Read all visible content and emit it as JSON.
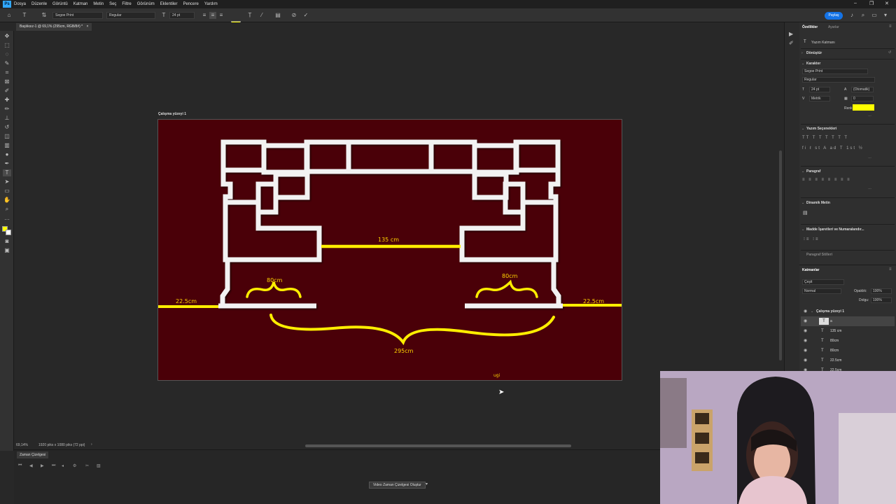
{
  "menubar": {
    "items": [
      "Dosya",
      "Düzenle",
      "Görüntü",
      "Katman",
      "Metin",
      "Seç",
      "Filtre",
      "Görünüm",
      "Eklentiler",
      "Pencere",
      "Yardım"
    ]
  },
  "options": {
    "font_family": "Segoe Print",
    "font_style": "Regular",
    "font_size": "24 pt",
    "color": "#ffff00",
    "share_label": "Paylaş"
  },
  "document": {
    "tab_title": "Başlıksız-1 @ 69,1% (295cm, RGB/8#) *",
    "artboard_label": "Çalışma yüzeyi 1"
  },
  "canvas": {
    "background": "#4a0008",
    "labels": {
      "middle": "135 cm",
      "left_shelf": "80cm",
      "right_shelf": "80cm",
      "left_side": "22.5cm",
      "right_side": "22.5cm",
      "total": "295cm",
      "typing": "ugi"
    }
  },
  "status": {
    "zoom": "69,14%",
    "size": "1920 piks x 1080 piks (72 ppi)"
  },
  "timeline": {
    "tab": "Zaman Çizelgesi",
    "create_button": "Video Zaman Çizelgesi Oluştur"
  },
  "properties": {
    "tabs": [
      "Özellikler",
      "Ayarlar"
    ],
    "layer_type": "Yazım Katmanı",
    "sections": {
      "transform": "Dönüştür",
      "character": "Karakter",
      "type_options": "Yazım Seçenekleri",
      "paragraph": "Paragraf",
      "dynamic_text": "Dinamik Metin",
      "bullets": "Madde İşaretleri ve Numaralandır...",
      "paragraph_styles": "Paragraf Stilleri"
    },
    "font_family": "Segoe Print",
    "font_style": "Regular",
    "size": "24 pt",
    "leading": "(Otomatik)",
    "kerning": "Metrik",
    "tracking": "0",
    "color_label": "Renk",
    "color": "#ffff00"
  },
  "layers": {
    "title": "Katmanlar",
    "search_placeholder": "Çeşit",
    "blend_mode": "Normal",
    "opacity_label": "Opaklık:",
    "opacity": "100%",
    "fill_label": "Dolgu:",
    "fill": "100%",
    "artboard": "Çalışma yüzeyi 1",
    "items": [
      "a",
      "135 cm",
      "80cm",
      "80cm",
      "22.5cm",
      "22.5cm"
    ]
  }
}
